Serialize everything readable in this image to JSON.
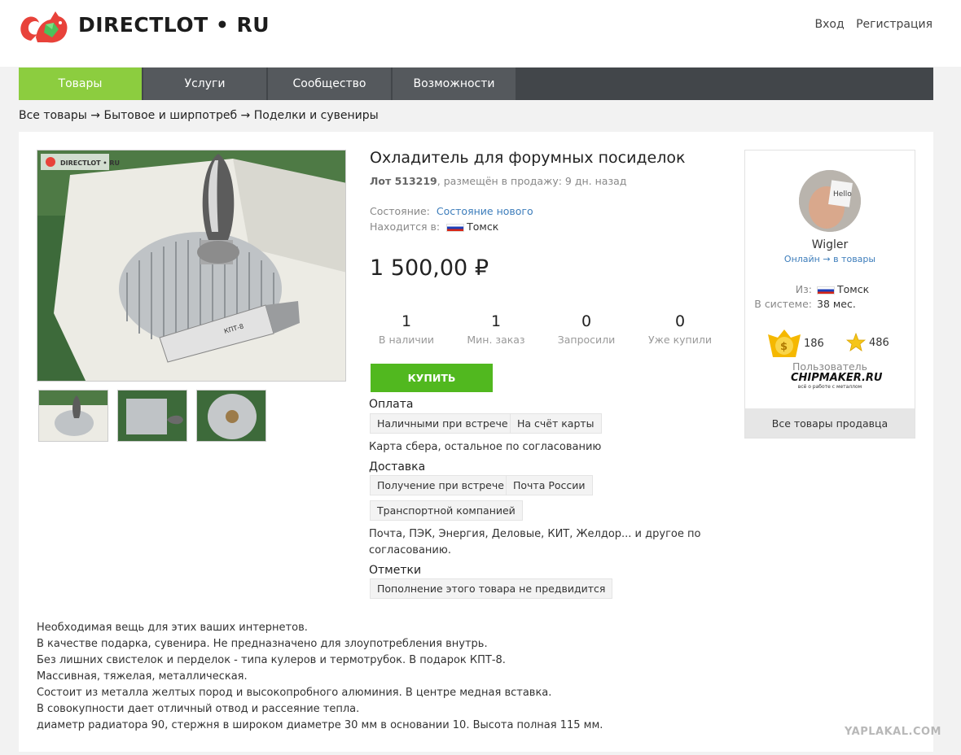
{
  "header": {
    "logo_text": "DIRECTLOT • RU",
    "login": "Вход",
    "register": "Регистрация"
  },
  "nav": {
    "items": [
      {
        "label": "Товары",
        "active": true
      },
      {
        "label": "Услуги"
      },
      {
        "label": "Сообщество"
      },
      {
        "label": "Возможности"
      }
    ]
  },
  "breadcrumb": "Все товары → Бытовое и ширпотреб → Поделки и сувениры",
  "product": {
    "photo_watermark": "DIRECTLOT • RU",
    "title": "Охладитель для форумных посиделок",
    "lot_number": "Лот 513219",
    "lot_posted": ", размещён в продажу: 9 дн. назад",
    "condition_label": "Состояние:",
    "condition_value": "Состояние нового",
    "location_label": "Находится в:",
    "location_value": "Томск",
    "price": "1 500,00 ₽",
    "stats": [
      {
        "num": "1",
        "label": "В наличии"
      },
      {
        "num": "1",
        "label": "Мин. заказ"
      },
      {
        "num": "0",
        "label": "Запросили"
      },
      {
        "num": "0",
        "label": "Уже купили"
      }
    ],
    "buy_label": "КУПИТЬ",
    "payment_title": "Оплата",
    "payment_tags": [
      "Наличными при встрече",
      "На счёт карты"
    ],
    "payment_note": "Карта сбера, остальное по согласованию",
    "delivery_title": "Доставка",
    "delivery_tags": [
      "Получение при встрече",
      "Почта России",
      "Транспортной компанией"
    ],
    "delivery_note_1": "Почта, ПЭК, Энергия, Деловые, КИТ, Желдор... и другое по",
    "delivery_note_2": "согласованию.",
    "marks_title": "Отметки",
    "marks_tags": [
      "Пополнение этого товара не предвидится"
    ]
  },
  "seller": {
    "name": "Wigler",
    "online": "Онлайн → в товары",
    "from_label": "Из:",
    "from_value": "Томск",
    "in_system_label": "В системе:",
    "in_system_value": "38 мес.",
    "rating_money": "186",
    "rating_star": "486",
    "user_label": "Пользователь",
    "badge": "CHIPMAKER.RU",
    "badge_sub": "всё о работе с металлом",
    "all_goods": "Все товары продавца"
  },
  "description": [
    "Необходимая вещь для этих ваших интернетов.",
    "В качестве подарка, сувенира. Не предназначено для злоупотребления внутрь.",
    "Без лишних свистелок и перделок - типа кулеров и термотрубок. В подарок КПТ-8.",
    "Массивная, тяжелая, металлическая.",
    "Состоит из металла желтых пород и высокопробного алюминия. В центре медная вставка.",
    "В совокупности дает отличный отвод и рассеяние тепла.",
    "диаметр радиатора 90, стержня в широком диаметре 30 мм в основании 10. Высота полная 115 мм."
  ],
  "watermark": "YAPLAKAL.COM",
  "colors": {
    "nav_active": "#8ccd3f",
    "buy_button": "#51b81f",
    "link": "#3d7dbb"
  }
}
